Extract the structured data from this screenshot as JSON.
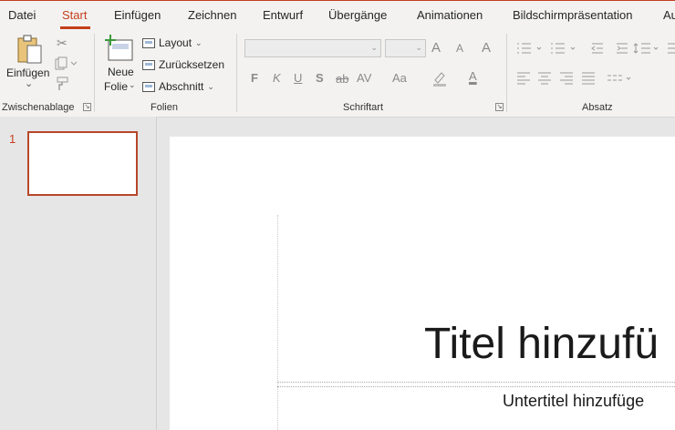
{
  "tabs": [
    {
      "label": "Datei"
    },
    {
      "label": "Start"
    },
    {
      "label": "Einfügen"
    },
    {
      "label": "Zeichnen"
    },
    {
      "label": "Entwurf"
    },
    {
      "label": "Übergänge"
    },
    {
      "label": "Animationen"
    },
    {
      "label": "Bildschirmpräsentation"
    },
    {
      "label": "Au"
    }
  ],
  "active_tab": "Start",
  "ribbon": {
    "clipboard": {
      "paste_label": "Einfügen",
      "paste_arrow": "⌄",
      "group_label": "Zwischenablage"
    },
    "slides": {
      "new_slide_line1": "Neue",
      "new_slide_line2": "Folie",
      "layout_label": "Layout",
      "reset_label": "Zurücksetzen",
      "section_label": "Abschnitt",
      "group_label": "Folien"
    },
    "font": {
      "bold": "F",
      "italic": "K",
      "underline": "U",
      "shadow": "S",
      "strike": "ab",
      "spacing": "AV",
      "case": "Aa",
      "grow": "A",
      "shrink": "A",
      "clear": "A",
      "font_color": "A",
      "group_label": "Schriftart"
    },
    "paragraph": {
      "group_label": "Absatz"
    }
  },
  "thumbnails": [
    {
      "number": "1"
    }
  ],
  "slide": {
    "title": "Titel hinzufü",
    "subtitle": "Untertitel hinzufüge"
  },
  "colors": {
    "accent": "#c43e1c",
    "ribbon_bg": "#f3f2f1",
    "workspace_bg": "#e6e6e6"
  }
}
